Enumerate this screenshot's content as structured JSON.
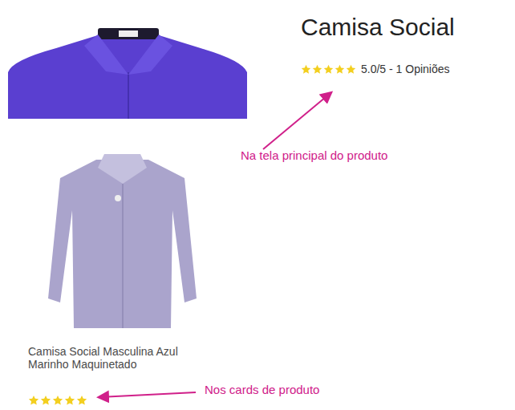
{
  "product_page": {
    "title": "Camisa Social",
    "rating": {
      "stars": 5,
      "text": "5.0/5 - 1 Opiniões"
    }
  },
  "product_card": {
    "name": "Camisa Social Masculina Azul Marinho Maquinetado",
    "stars": 5
  },
  "annotations": [
    {
      "label": "Na tela principal do produto"
    },
    {
      "label": "Nos cards de produto"
    }
  ]
}
